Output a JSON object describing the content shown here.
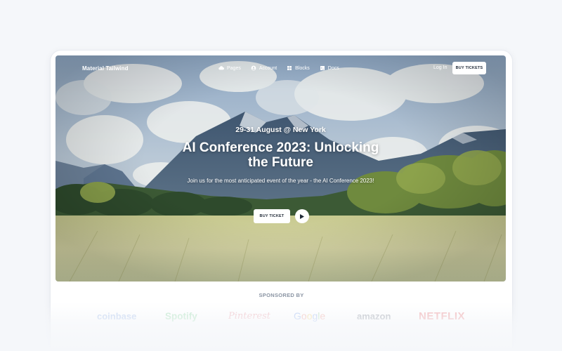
{
  "navbar": {
    "brand": "Material Tailwind",
    "items": [
      {
        "label": "Pages",
        "icon": "cloud-icon"
      },
      {
        "label": "Account",
        "icon": "user-circle-icon"
      },
      {
        "label": "Blocks",
        "icon": "grid-icon"
      },
      {
        "label": "Docs",
        "icon": "terminal-icon"
      }
    ],
    "login_label": "Log In",
    "buy_tickets_label": "BUY TICKETS"
  },
  "hero": {
    "date": "29-31 August @ New York",
    "title": "AI Conference 2023: Unlocking the Future",
    "subtitle": "Join us for the most anticipated event of the year - the AI Conference 2023!",
    "buy_ticket_label": "BUY TICKET"
  },
  "sponsors": {
    "heading": "SPONSORED BY",
    "logos": [
      "coinbase",
      "Spotify",
      "Pinterest",
      "Google",
      "amazon",
      "NETFLIX"
    ]
  },
  "colors": {
    "page_bg": "#f5f7fa",
    "card_bg": "#ffffff",
    "button_bg": "#ffffff",
    "button_text": "#1f2937"
  }
}
